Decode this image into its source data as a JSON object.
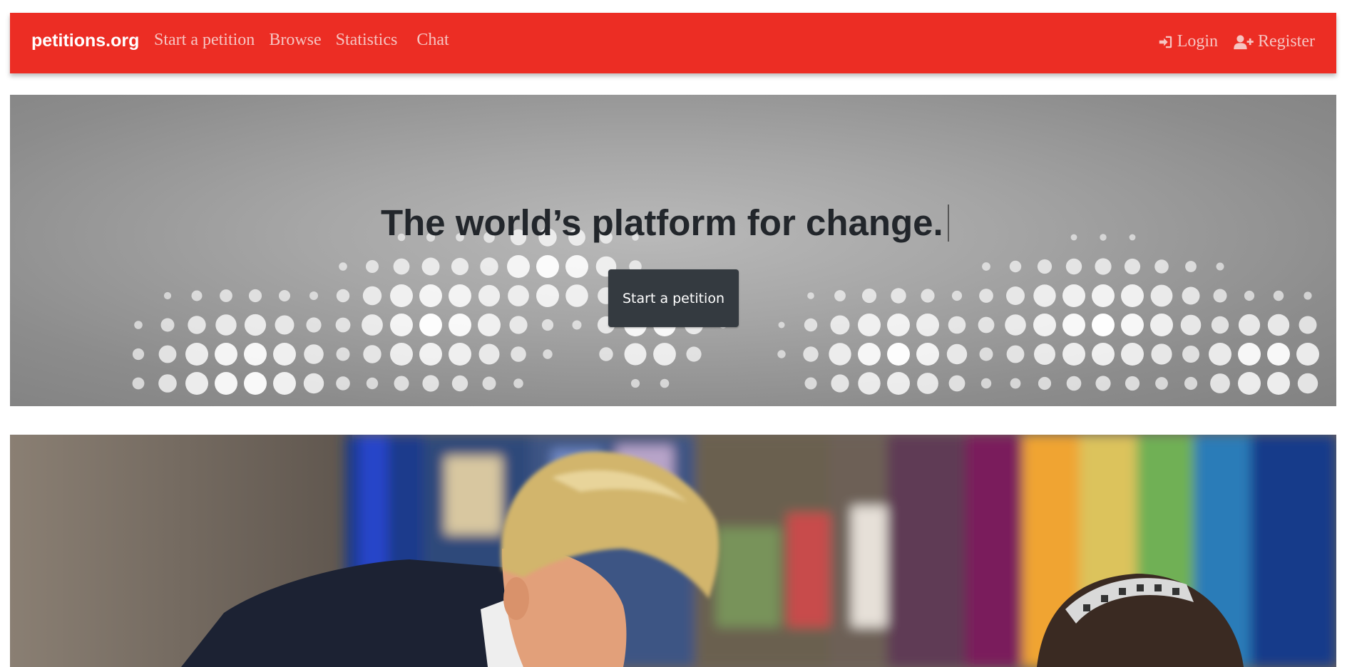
{
  "navbar": {
    "brand": "petitions.org",
    "links": [
      {
        "label": "Start a petition"
      },
      {
        "label": "Browse"
      },
      {
        "label": "Statistics"
      },
      {
        "label": "Chat"
      }
    ],
    "login_label": "Login",
    "register_label": "Register",
    "login_icon": "sign-in-icon",
    "register_icon": "user-plus-icon",
    "background_color": "#ec2d24",
    "link_color": "#f6c4c1"
  },
  "hero": {
    "title": "The world’s platform for change.",
    "button_label": "Start a petition",
    "button_color": "#343a40"
  },
  "featured_image": {
    "subject": "photo"
  }
}
